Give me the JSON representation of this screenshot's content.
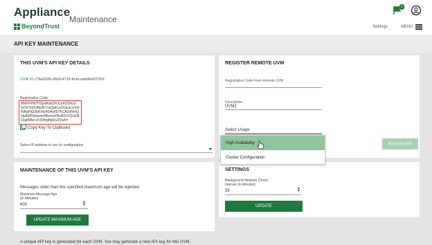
{
  "header": {
    "app_name": "Appliance",
    "brand": "BeyondTrust",
    "title": "Maintenance",
    "notification_count": "1",
    "settings_link": "Settings",
    "menu_link": "MENU"
  },
  "page": {
    "title": "API KEY MAINTENANCE"
  },
  "api_key_details": {
    "title": "THIS UVM'S API KEY DETAILS",
    "uvm_id_label": "UVM ID",
    "uvm_id_value": "c78a2026-28c8-4715-bcfa-ceb96e53791f",
    "reg_code_label": "Registration Code",
    "reg_code_value": "MWVnHb7H3ymKiw1PULmh22rks3G/1EYqSVAp3F7xxQaEyx2GjceccmMWRpPjQ2kKXbxKb4yfID7kCA2uNmQolpAWOlebwm0BernaYAsl82LFQzIZAOupf6Bs+2r2DfvgMpb1/iQwA=",
    "copy_label": "Copy Key To Clipboard",
    "ip_label": "Select IP address to use for configuration"
  },
  "register_remote": {
    "title": "REGISTER REMOTE UVM",
    "reg_code_label": "Registration Code From Remote UVM",
    "description_label": "Description",
    "description_value": "UVM2",
    "usage_placeholder": "Select Usage",
    "usage_options": [
      "High Availability",
      "Cluster Configuration"
    ],
    "add_button": "ADD/UPDATE"
  },
  "maintenance": {
    "title": "MAINTENANCE OF THIS UVM'S API KEY",
    "message": "Messages older than the specified maximum age will be rejected.",
    "max_age_label": "Maximum Message Age (In Minutes)",
    "max_age_value": "600",
    "update_button": "UPDATE MAXIMUM AGE",
    "footer": "A unique API key is generated for each UVM. You may generate a new API key for this UVM."
  },
  "settings": {
    "title": "SETTINGS",
    "interval_label": "Background Network Check Interval (In Minutes)",
    "interval_value": "59",
    "update_button": "UPDATE"
  },
  "colors": {
    "accent": "#1e7a3a",
    "highlight": "#8fc59b",
    "error_border": "#d93030",
    "disabled_button": "#a8d1b0"
  }
}
